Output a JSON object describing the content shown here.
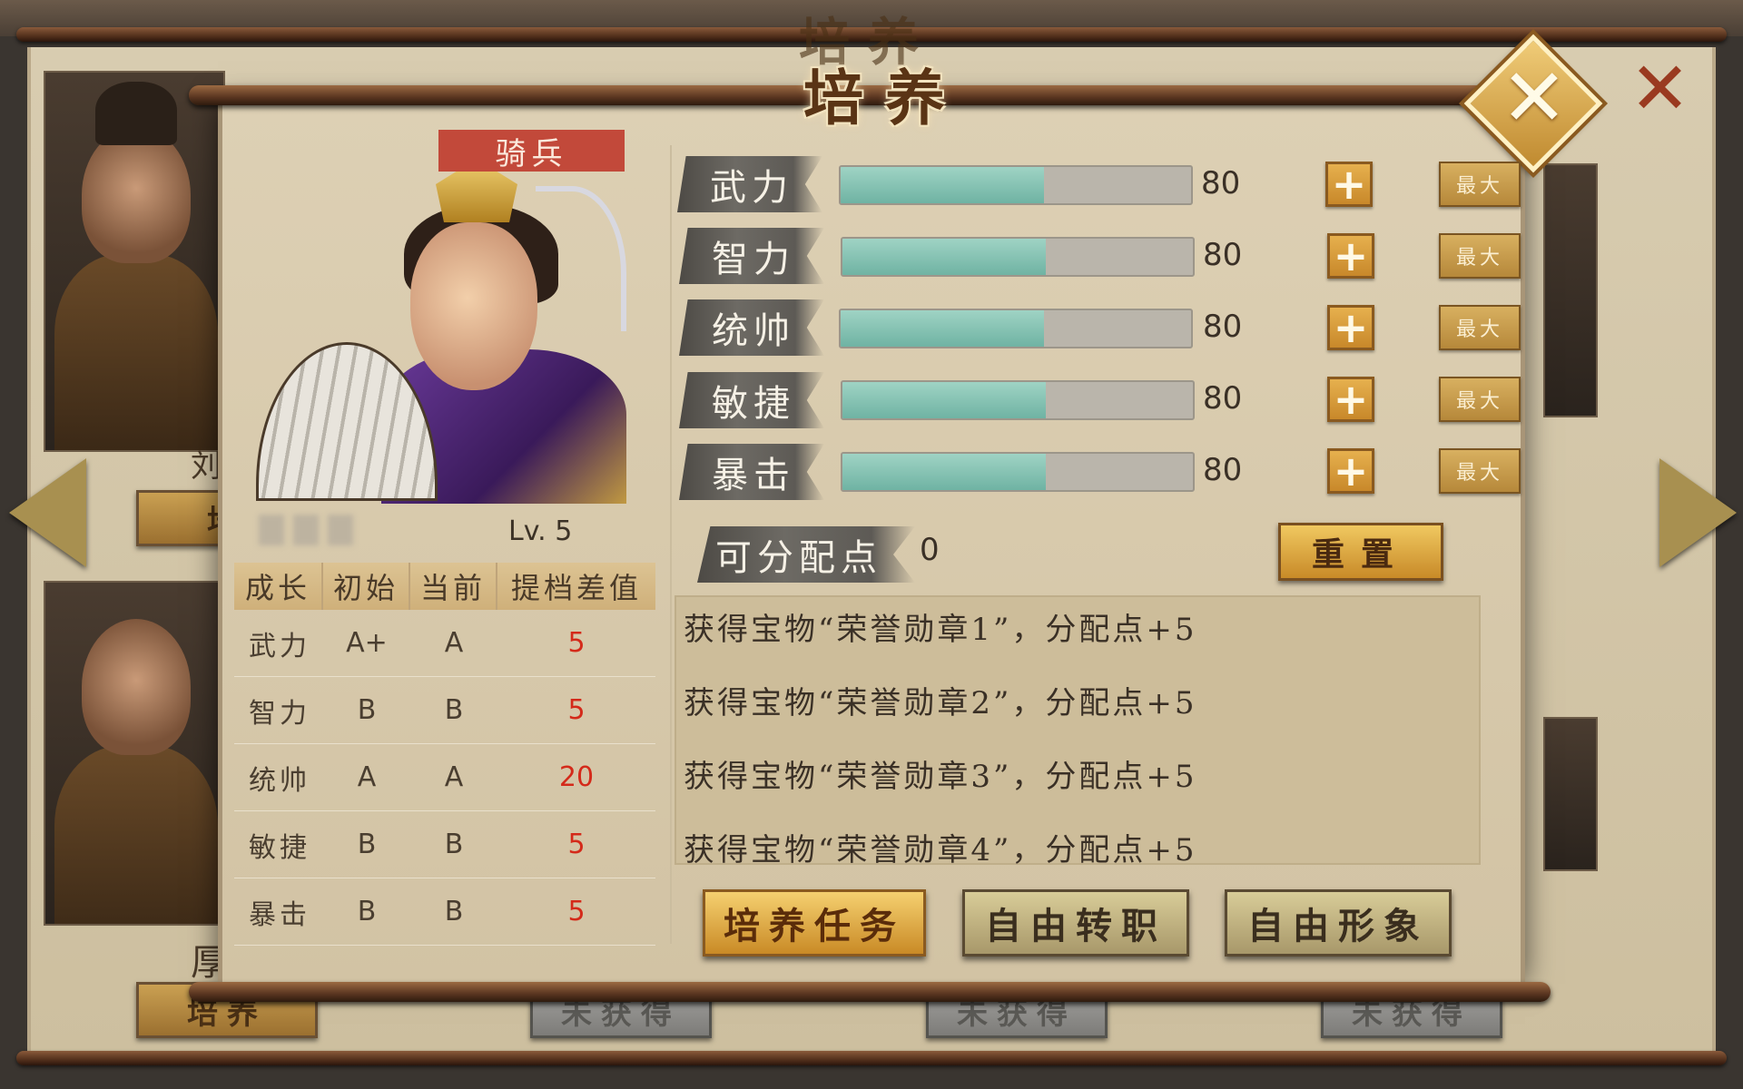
{
  "title": "培养",
  "background": {
    "left_buttons": [
      "培",
      "培养"
    ],
    "right_buttons": [
      "未获得",
      "未获得",
      "未获得"
    ],
    "partial_name_1": "刘",
    "partial_name_2": "厚"
  },
  "hero": {
    "class_badge": "骑兵",
    "level": "Lv. 5"
  },
  "growth_table": {
    "headers": [
      "成长",
      "初始",
      "当前",
      "提档差值"
    ],
    "rows": [
      {
        "stat": "武力",
        "initial": "A+",
        "current": "A",
        "diff": "5"
      },
      {
        "stat": "智力",
        "initial": "B",
        "current": "B",
        "diff": "5"
      },
      {
        "stat": "统帅",
        "initial": "A",
        "current": "A",
        "diff": "20"
      },
      {
        "stat": "敏捷",
        "initial": "B",
        "current": "B",
        "diff": "5"
      },
      {
        "stat": "暴击",
        "initial": "B",
        "current": "B",
        "diff": "5"
      }
    ]
  },
  "attributes": [
    {
      "name": "武力",
      "value": "80",
      "fill": 0.58
    },
    {
      "name": "智力",
      "value": "80",
      "fill": 0.58
    },
    {
      "name": "统帅",
      "value": "80",
      "fill": 0.58
    },
    {
      "name": "敏捷",
      "value": "80",
      "fill": 0.58
    },
    {
      "name": "暴击",
      "value": "80",
      "fill": 0.58
    }
  ],
  "plus_label": "+",
  "max_label": "最大",
  "points": {
    "label": "可分配点",
    "value": "0"
  },
  "reset_label": "重置",
  "log": [
    "获得宝物“荣誉勋章1”，分配点+5",
    "获得宝物“荣誉勋章2”，分配点+5",
    "获得宝物“荣誉勋章3”，分配点+5",
    "获得宝物“荣誉勋章4”，分配点+5"
  ],
  "actions": {
    "task": "培养任务",
    "free_job": "自由转职",
    "free_look": "自由形象"
  },
  "colors": {
    "accent_red": "#d42a1a",
    "bar_fill": "#7fc2b2",
    "badge": "#c2493a"
  }
}
